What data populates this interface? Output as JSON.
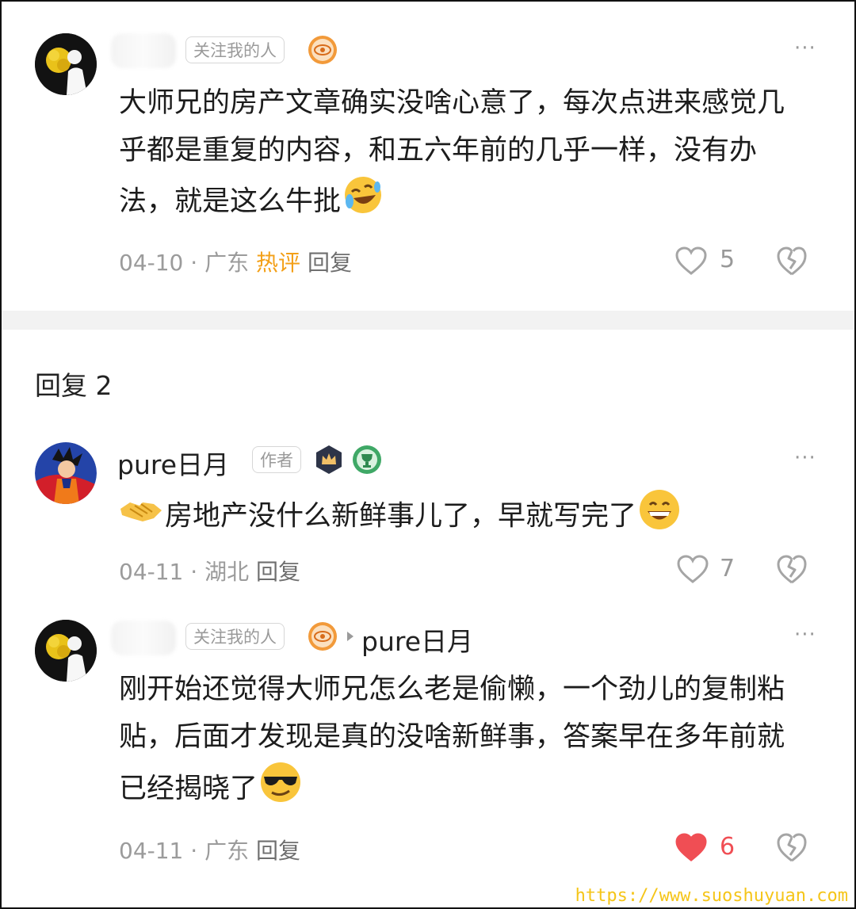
{
  "comment": {
    "tag": "关注我的人",
    "text": "大师兄的房产文章确实没啥心意了，每次点进来感觉几乎都是重复的内容，和五六年前的几乎一样，没有办法，就是这么牛批",
    "date": "04-10",
    "location": "广东",
    "hot_label": "热评",
    "reply_label": "回复",
    "likes": "5",
    "more": "···"
  },
  "replies_header": "回复 2",
  "replies": [
    {
      "name": "pure日月",
      "tag": "作者",
      "text": "房地产没什么新鲜事儿了，早就写完了",
      "date": "04-11",
      "location": "湖北",
      "reply_label": "回复",
      "likes": "7",
      "more": "···"
    },
    {
      "tag": "关注我的人",
      "reply_to": "pure日月",
      "text": "刚开始还觉得大师兄怎么老是偷懒，一个劲儿的复制粘贴，后面才发现是真的没啥新鲜事，答案早在多年前就已经揭晓了",
      "date": "04-11",
      "location": "广东",
      "reply_label": "回复",
      "likes": "6",
      "liked": true,
      "more": "···"
    }
  ],
  "watermark": "https://www.suoshuyuan.com",
  "colors": {
    "hot": "#f3a018",
    "liked": "#f04e54",
    "meta": "#9b9b9b"
  }
}
